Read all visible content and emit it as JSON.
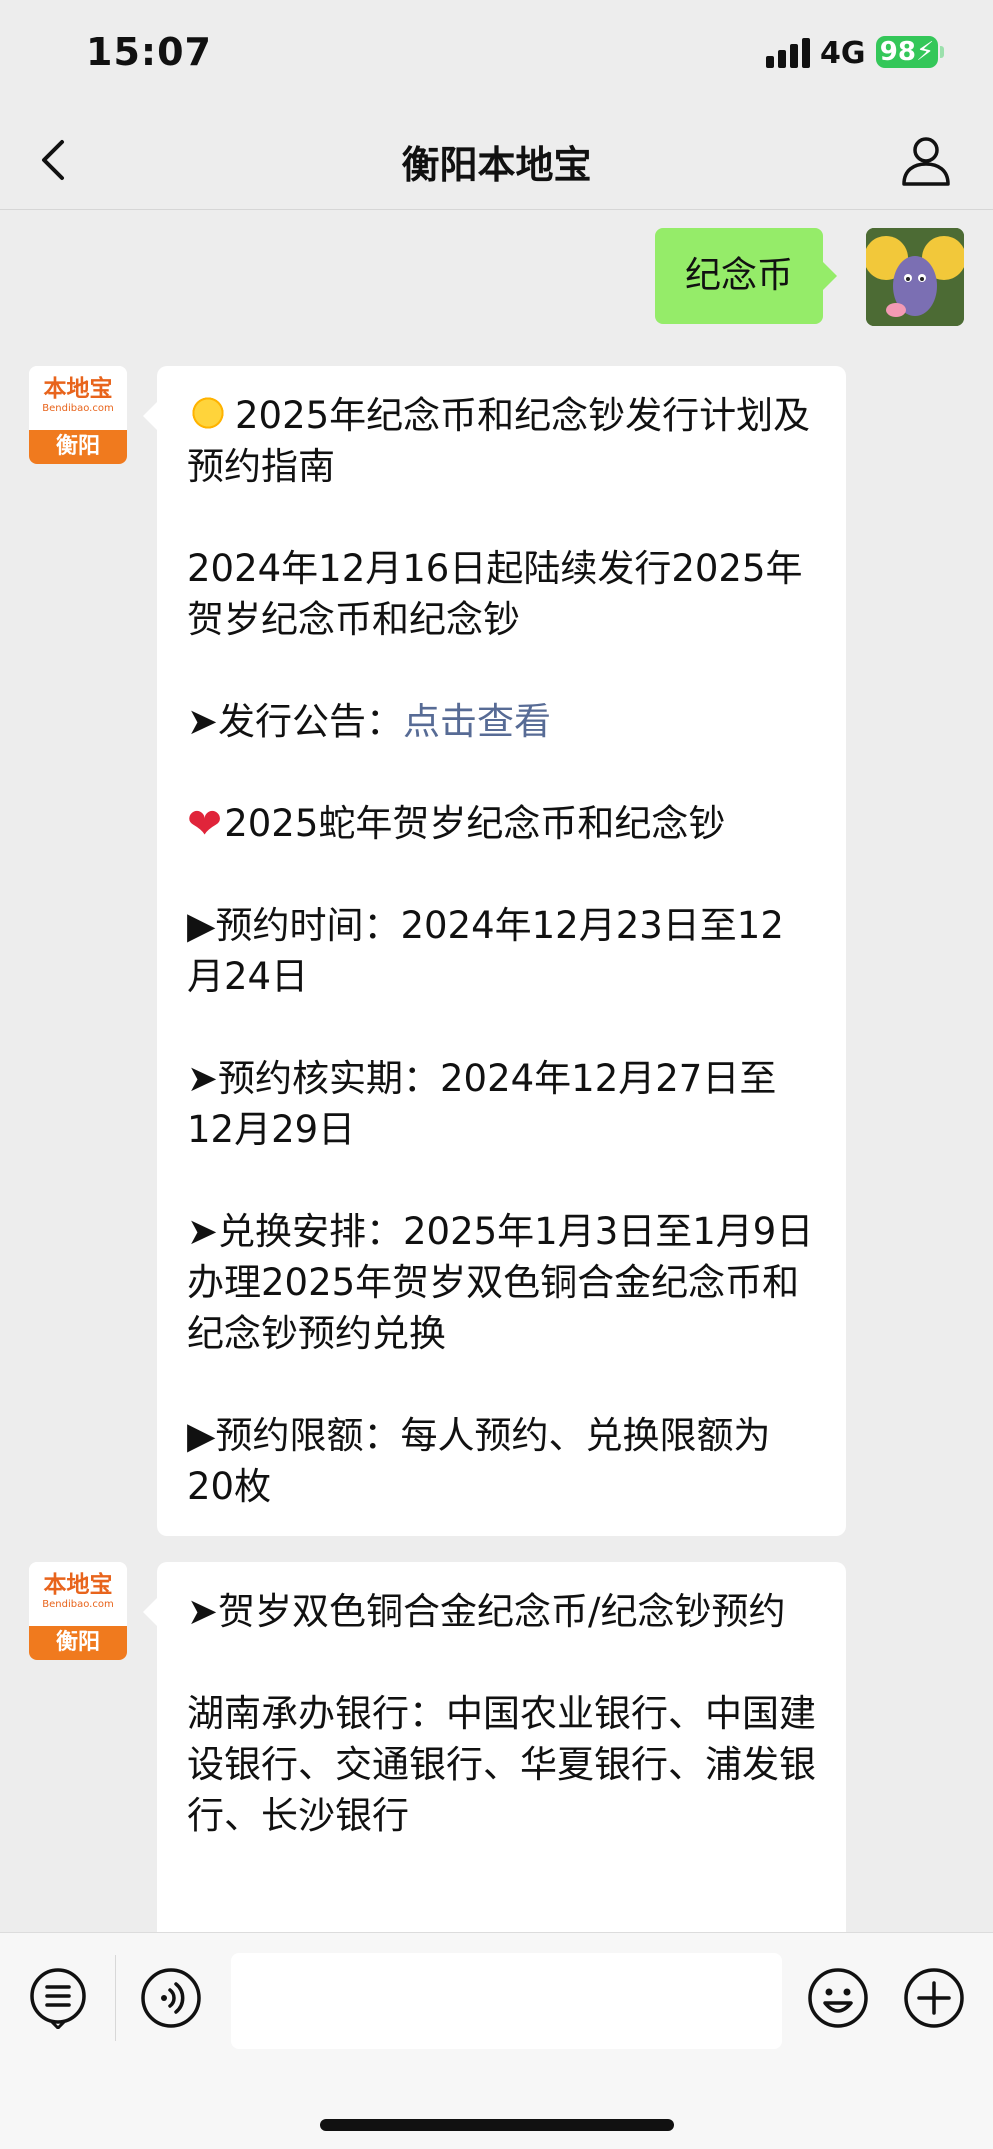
{
  "status_bar": {
    "time": "15:07",
    "network": "4G",
    "battery": "98"
  },
  "nav": {
    "title": "衡阳本地宝",
    "back_icon": "chevron-left-icon",
    "profile_icon": "person-icon"
  },
  "user_message": "纪念币",
  "bot": {
    "avatar_name": "本地宝",
    "avatar_url": "Bendibao.com",
    "avatar_city": "衡阳"
  },
  "messages": [
    {
      "lines": [
        "2025年纪念币和纪念钞发行计划及预约指南",
        "",
        "2024年12月16日起陆续发行2025年贺岁纪念币和纪念钞",
        "",
        "➤发行公告：",
        "",
        "2025蛇年贺岁纪念币和纪念钞",
        "",
        "▶预约时间：2024年12月23日至12月24日",
        "",
        "➤预约核实期：2024年12月27日至12月29日",
        "",
        "➤兑换安排：2025年1月3日至1月9日办理2025年贺岁双色铜合金纪念币和纪念钞预约兑换",
        "",
        "▶预约限额：每人预约、兑换限额为20枚"
      ],
      "link_text": "点击查看"
    },
    {
      "lines": [
        "➤贺岁双色铜合金纪念币/纪念钞预约",
        "",
        "湖南承办银行：中国农业银行、中国建设银行、交通银行、华夏银行、浦发银行、长沙银行"
      ]
    }
  ],
  "bottom_bar": {
    "menu_icon": "menu-list-icon",
    "voice_icon": "voice-icon",
    "emoji_icon": "emoji-icon",
    "plus_icon": "plus-icon"
  },
  "colors": {
    "user_bubble": "#95ec69",
    "link": "#576b95",
    "brand_orange": "#f07a1e",
    "battery": "#34c759"
  }
}
